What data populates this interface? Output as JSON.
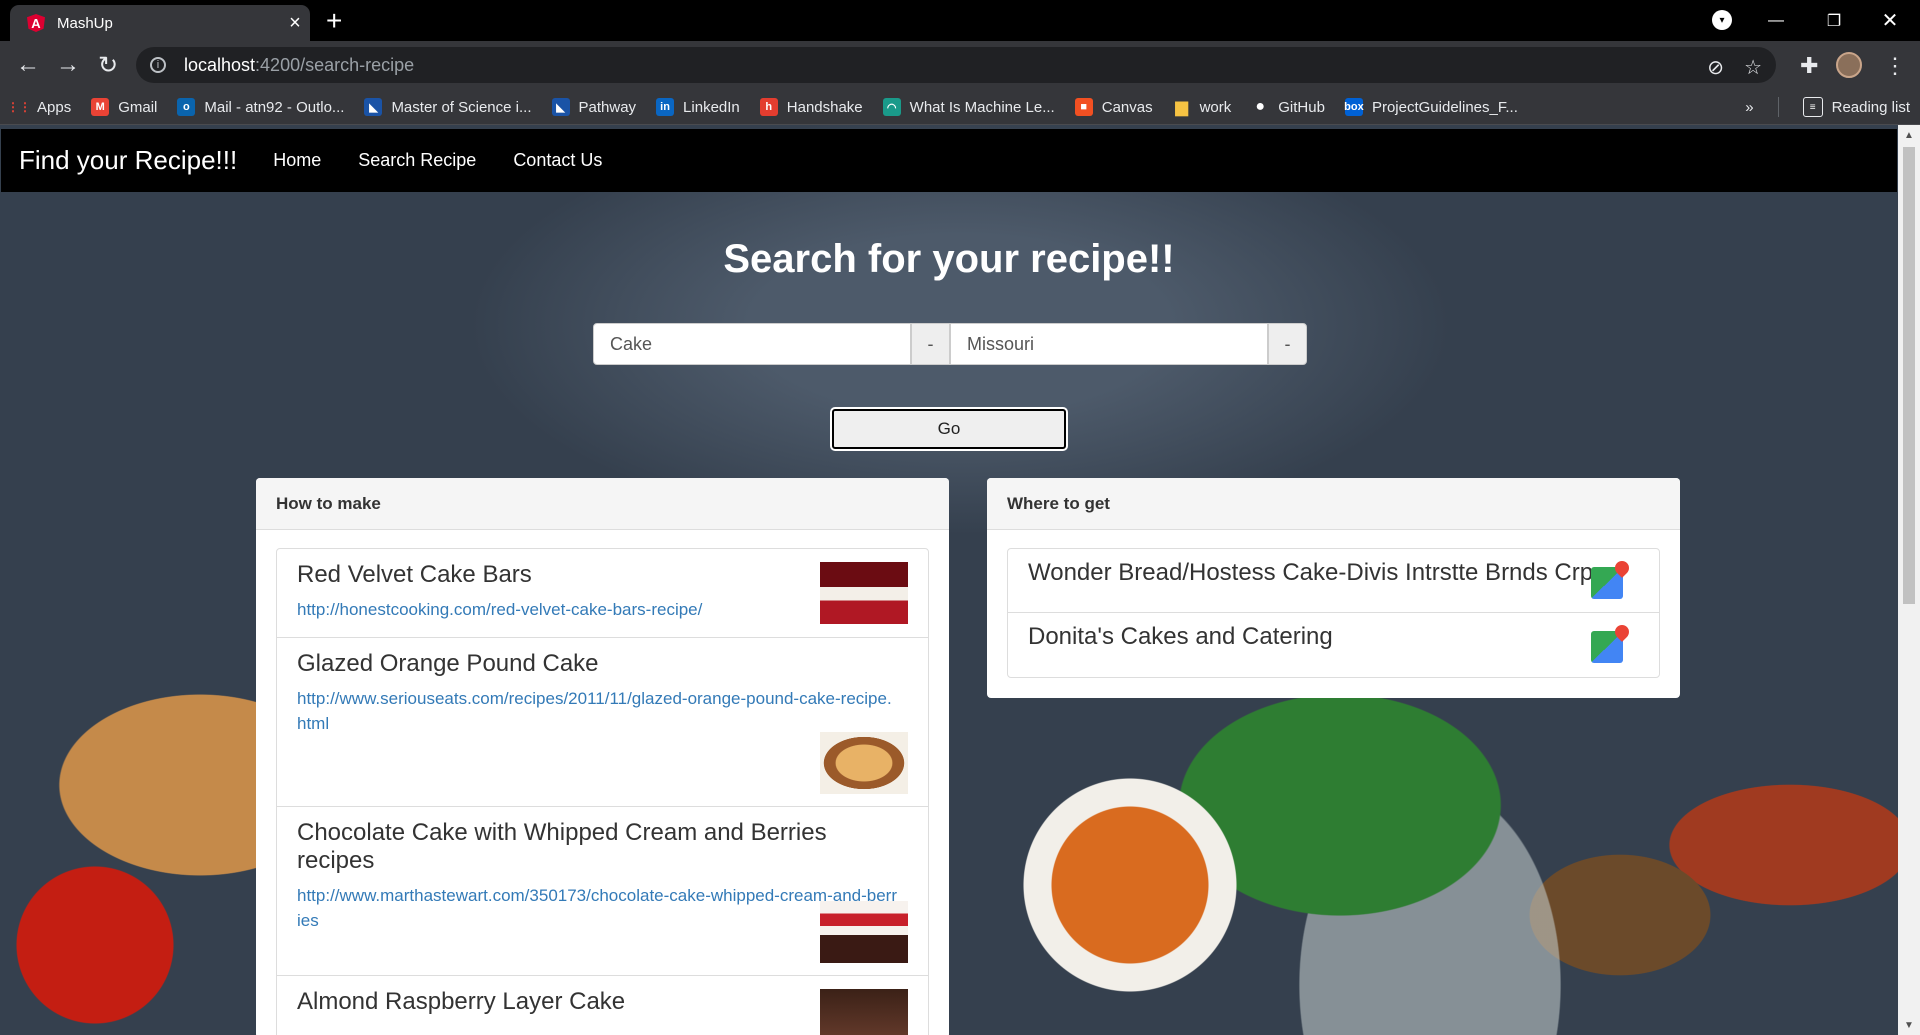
{
  "browser": {
    "tab_title": "MashUp",
    "url_host": "localhost",
    "url_path": ":4200/search-recipe",
    "bookmarks": [
      {
        "label": "Apps",
        "icon": "apps-grid-icon",
        "color": "#ea4335"
      },
      {
        "label": "Gmail",
        "icon": "gmail-icon",
        "color": "#ea4335"
      },
      {
        "label": "Mail - atn92 - Outlo...",
        "icon": "outlook-icon",
        "color": "#0a64ad"
      },
      {
        "label": "Master of Science i...",
        "icon": "university-icon",
        "color": "#1a53a6"
      },
      {
        "label": "Pathway",
        "icon": "pathway-icon",
        "color": "#1a53a6"
      },
      {
        "label": "LinkedIn",
        "icon": "linkedin-icon",
        "color": "#0a66c2"
      },
      {
        "label": "Handshake",
        "icon": "handshake-icon",
        "color": "#e33d2f"
      },
      {
        "label": "What Is Machine Le...",
        "icon": "ml-icon",
        "color": "#1a9a8a"
      },
      {
        "label": "Canvas",
        "icon": "canvas-icon",
        "color": "#f25022"
      },
      {
        "label": "work",
        "icon": "folder-icon",
        "color": "#f6c343"
      },
      {
        "label": "GitHub",
        "icon": "github-icon",
        "color": "#ffffff"
      },
      {
        "label": "ProjectGuidelines_F...",
        "icon": "box-icon",
        "color": "#0061d5"
      }
    ],
    "overflow": "»",
    "reading_list": "Reading list"
  },
  "app": {
    "brand": "Find your Recipe!!!",
    "nav": [
      "Home",
      "Search Recipe",
      "Contact Us"
    ],
    "heading": "Search for your recipe!!",
    "search": {
      "recipe_value": "Cake",
      "location_value": "Missouri",
      "addon": "-",
      "go_label": "Go"
    },
    "how_to_make": {
      "header": "How to make",
      "recipes": [
        {
          "title": "Red Velvet Cake Bars",
          "url": "http://honestcooking.com/red-velvet-cake-bars-recipe/"
        },
        {
          "title": "Glazed Orange Pound Cake",
          "url": "http://www.seriouseats.com/recipes/2011/11/glazed-orange-pound-cake-recipe.html"
        },
        {
          "title": "Chocolate Cake with Whipped Cream and Berries recipes",
          "url": "http://www.marthastewart.com/350173/chocolate-cake-whipped-cream-and-berries"
        },
        {
          "title": "Almond Raspberry Layer Cake",
          "url": ""
        }
      ]
    },
    "where_to_get": {
      "header": "Where to get",
      "stores": [
        "Wonder Bread/Hostess Cake-Divis Intrstte Brnds Crp",
        "Donita's Cakes and Catering"
      ]
    }
  }
}
